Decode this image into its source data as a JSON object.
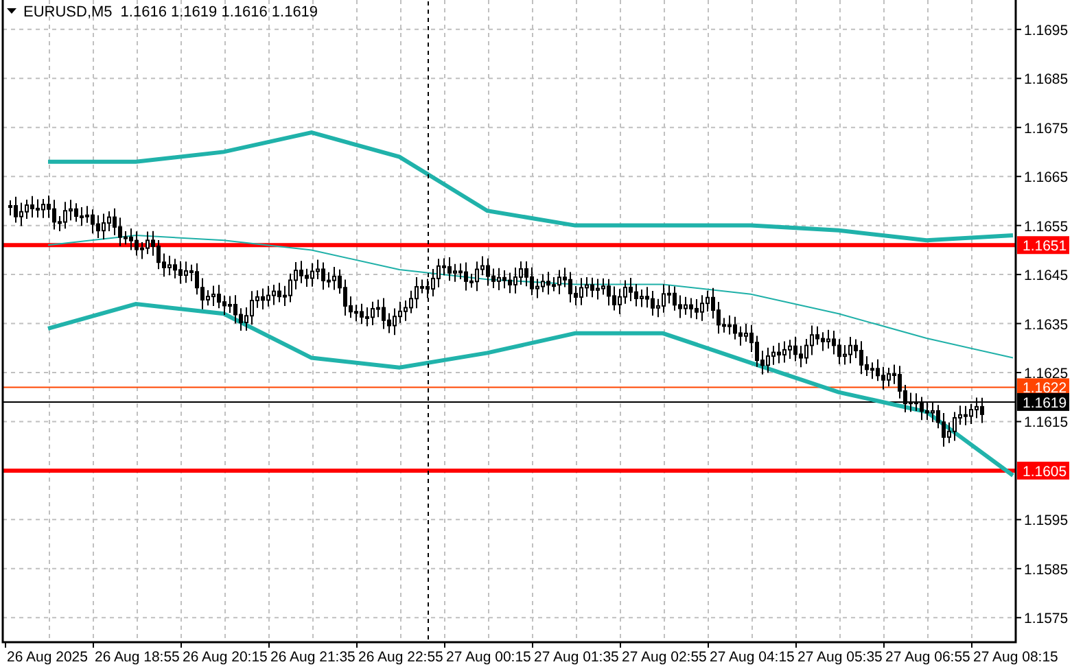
{
  "header": {
    "symbol": "EURUSD,M5",
    "ohlc": "1.1616 1.1619 1.1616 1.1619"
  },
  "chart": {
    "chart_data": {
      "type": "line",
      "categories": [
        "26 Aug 2025",
        "26 Aug 18:55",
        "26 Aug 20:15",
        "26 Aug 21:35",
        "26 Aug 22:55",
        "27 Aug 00:15",
        "27 Aug 01:35",
        "27 Aug 02:55",
        "27 Aug 04:15",
        "27 Aug 05:35",
        "27 Aug 06:55",
        "27 Aug 08:15"
      ],
      "ylim": [
        1.157,
        1.1701
      ],
      "yticks": [
        1.1695,
        1.1685,
        1.1675,
        1.1665,
        1.1655,
        1.1645,
        1.1635,
        1.1625,
        1.1615,
        1.1595,
        1.1585,
        1.1575
      ],
      "grid": true,
      "series": [
        {
          "color": "#20b2aa",
          "values": [
            1.1668,
            1.1668,
            1.167,
            1.1674,
            1.1669,
            1.1658,
            1.1655,
            1.1655,
            1.1655,
            1.1654,
            1.1652,
            1.1653
          ]
        },
        {
          "color": "#1fb0a8",
          "values": [
            1.1651,
            1.1653,
            1.1652,
            1.165,
            1.1646,
            1.1644,
            1.1643,
            1.1643,
            1.1641,
            1.1637,
            1.1632,
            1.1628
          ]
        },
        {
          "color": "#21b3ab",
          "values": [
            1.1634,
            1.1639,
            1.1637,
            1.1628,
            1.1626,
            1.1629,
            1.1633,
            1.1633,
            1.1627,
            1.1621,
            1.1617,
            1.1604
          ]
        }
      ],
      "ref_lines": [
        {
          "axis": "y",
          "value": 1.1651,
          "label": "1.1651",
          "color": "#ff0000"
        },
        {
          "axis": "y",
          "value": 1.1622,
          "label": "1.1622",
          "color": "#ff4500"
        },
        {
          "axis": "y",
          "value": 1.1619,
          "label": "1.1619",
          "color": "#000000"
        },
        {
          "axis": "y",
          "value": 1.1605,
          "label": "1.1605",
          "color": "#ff0000"
        }
      ]
    }
  }
}
